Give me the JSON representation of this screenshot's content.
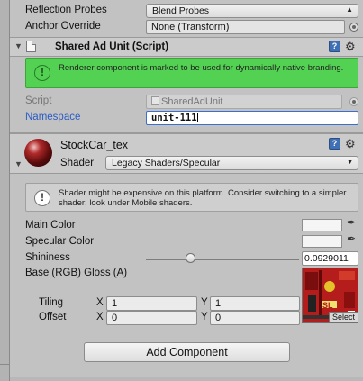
{
  "colors": {
    "panel_bg": "#c2c2c2",
    "success_bg": "#53d153",
    "focus_blue": "#3a6fd1",
    "texture_red": "#b51d1d"
  },
  "top_rows": {
    "reflection_probes": {
      "label": "Reflection Probes",
      "value": "Blend Probes"
    },
    "anchor_override": {
      "label": "Anchor Override",
      "value": "None (Transform)"
    }
  },
  "script_component": {
    "title": "Shared Ad Unit (Script)",
    "message": "Renderer component is marked to be used for dynamically native branding.",
    "script_label": "Script",
    "script_value": "SharedAdUnit",
    "namespace_label": "Namespace",
    "namespace_value": "unit-111"
  },
  "material": {
    "name": "StockCar_tex",
    "shader_label": "Shader",
    "shader_value": "Legacy Shaders/Specular",
    "warning": "Shader might be expensive on this platform. Consider switching to a simpler shader; look under Mobile shaders.",
    "main_color_label": "Main Color",
    "specular_color_label": "Specular Color",
    "shininess_label": "Shininess",
    "shininess_value": "0.0929011",
    "shininess_fraction": 0.29,
    "base_label": "Base (RGB) Gloss (A)",
    "tiling_label": "Tiling",
    "offset_label": "Offset",
    "x_label": "X",
    "y_label": "Y",
    "tiling_x": "1",
    "tiling_y": "1",
    "offset_x": "0",
    "offset_y": "0",
    "select_label": "Select"
  },
  "add_component_label": "Add Component",
  "icons": {
    "help": "help-book-icon",
    "gear": "gear-icon",
    "fold": "foldout-triangle-icon",
    "pipette": "eyedropper-icon",
    "info": "exclamation-circle-icon"
  }
}
